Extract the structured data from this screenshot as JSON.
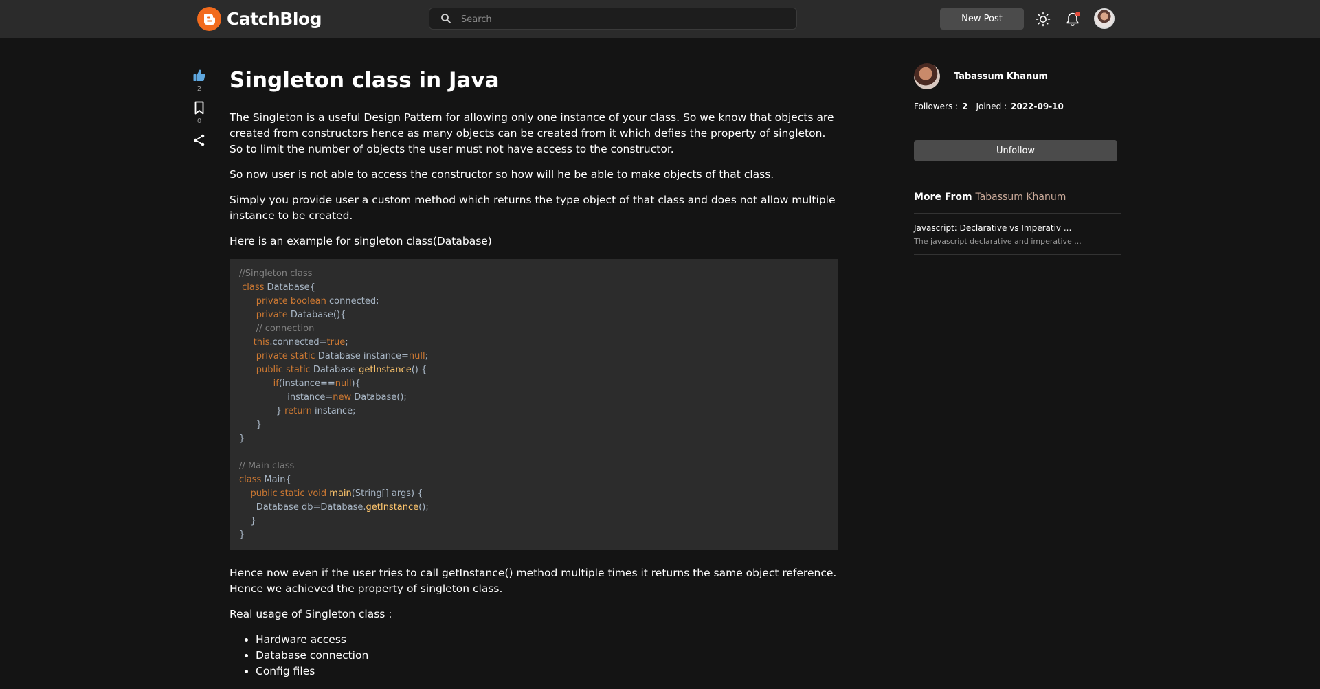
{
  "header": {
    "brand": "CatchBlog",
    "search_placeholder": "Search",
    "new_post_label": "New Post"
  },
  "actions": {
    "likes": "2",
    "bookmarks": "0"
  },
  "article": {
    "title": "Singleton class in Java",
    "paragraphs": [
      "The Singleton is a useful Design Pattern for allowing only one instance of your class. So we know that objects are created from constructors hence as many objects can be created from it which defies the property of singleton. So to limit the number of objects the user must not have access to the constructor.",
      "So now user is not able to access the constructor so how will he be able to make objects of that class.",
      "Simply you provide user a custom method which returns the type object of that class and does not allow multiple instance to be created.",
      "Here is an example for singleton class(Database)"
    ],
    "code": [
      "//Singleton class",
      " class Database{",
      "      private boolean connected;",
      "      private Database(){",
      "      // connection",
      "     this.connected=true;",
      "      private static Database instance=null;",
      "      public static Database getInstance() {",
      "            if(instance==null){",
      "                 instance=new Database();",
      "             } return instance;",
      "      }",
      "}",
      "",
      "// Main class",
      "class Main{",
      "    public static void main(String[] args) {",
      "      Database db=Database.getInstance();",
      "    }",
      "}"
    ],
    "after_paragraphs": [
      "Hence now even if the user tries to call getInstance() method multiple times it returns the same object reference. Hence we achieved the property of singleton class.",
      "Real usage of Singleton class :"
    ],
    "list": [
      "Hardware access",
      "Database connection",
      "Config files"
    ]
  },
  "author": {
    "name": "Tabassum Khanum",
    "followers_label": "Followers :",
    "followers": "2",
    "joined_label": "Joined :",
    "joined": "2022-09-10",
    "bio": "-",
    "unfollow_label": "Unfollow",
    "more_from_label": "More From",
    "more_posts": [
      {
        "title": "Javascript: Declarative vs Imperativ ...",
        "excerpt": "The javascript declarative and imperative ..."
      }
    ]
  },
  "colors": {
    "background": "#141414",
    "topbar": "#2b2b2b",
    "brand": "#f26b1d",
    "like_icon": "#5fa8e0",
    "notification_dot": "#e74c3c",
    "code_keyword": "#cc7832",
    "code_function": "#ffc66d",
    "code_comment": "#808080"
  }
}
